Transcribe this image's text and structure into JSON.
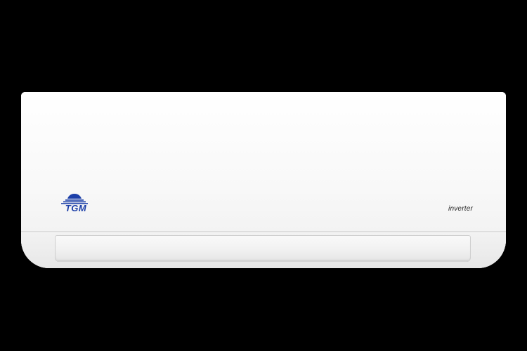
{
  "image": {
    "background_color": "#000000",
    "subject": "air-conditioner-indoor-unit"
  },
  "unit": {
    "brand": "TGM",
    "label": "inverter",
    "brand_color": "#1c3fa8"
  }
}
